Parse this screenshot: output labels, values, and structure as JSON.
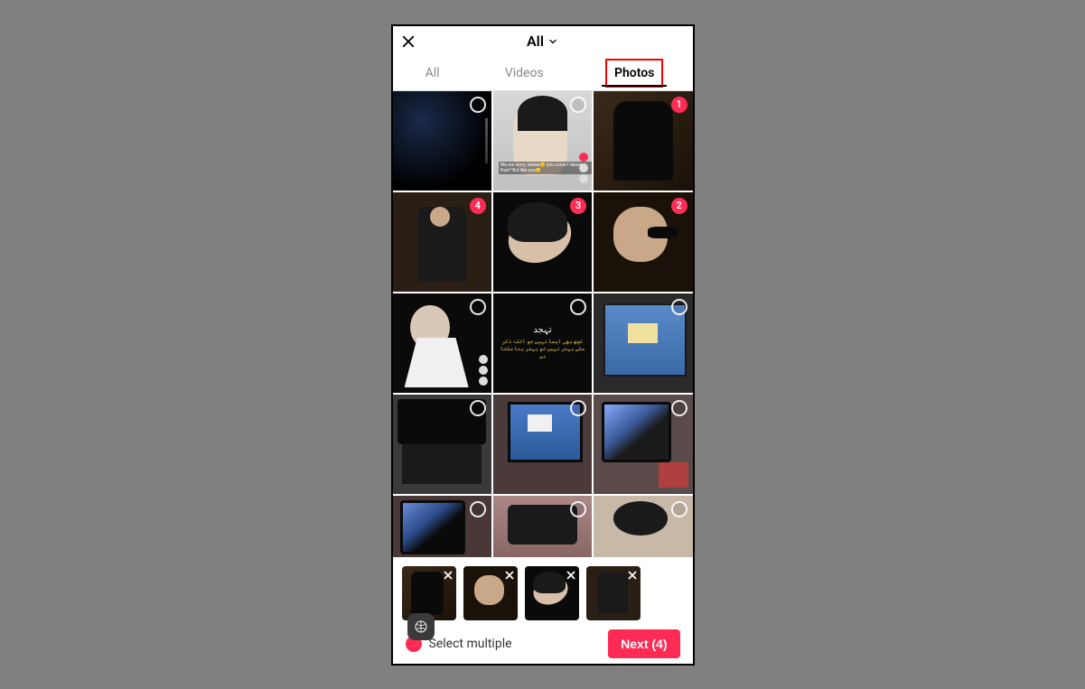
{
  "header": {
    "title": "All"
  },
  "tabs": {
    "all": "All",
    "videos": "Videos",
    "photos": "Photos",
    "active": "Photos",
    "highlighted": "Photos"
  },
  "grid": {
    "items": [
      {
        "id": "t1",
        "selected": false
      },
      {
        "id": "t2",
        "selected": false,
        "caption": "We are sorry, taetae😔\nyou come f deserve\nPain? But like you😔"
      },
      {
        "id": "t3",
        "selected": true,
        "badge": "1"
      },
      {
        "id": "t4",
        "selected": true,
        "badge": "4"
      },
      {
        "id": "t5",
        "selected": true,
        "badge": "3"
      },
      {
        "id": "t6",
        "selected": true,
        "badge": "2"
      },
      {
        "id": "t7",
        "selected": false
      },
      {
        "id": "t8",
        "selected": false,
        "text_top": "تہجد",
        "text_body": "کچھ بھی ایسا نہیں جو اللہ ذکر\nسکے بہتر نہیں تو بہتر بنا سکتا ہے"
      },
      {
        "id": "t9",
        "selected": false
      },
      {
        "id": "t10",
        "selected": false
      },
      {
        "id": "t11",
        "selected": false
      },
      {
        "id": "t12",
        "selected": false
      },
      {
        "id": "t13",
        "selected": false
      },
      {
        "id": "t14",
        "selected": false
      },
      {
        "id": "t15",
        "selected": false
      }
    ]
  },
  "selected_tray": [
    {
      "ref": "s1"
    },
    {
      "ref": "s2"
    },
    {
      "ref": "s3"
    },
    {
      "ref": "s4"
    }
  ],
  "footer": {
    "select_multiple_label": "Select multiple",
    "next_label": "Next (4)"
  },
  "colors": {
    "accent": "#fe2c55",
    "highlight_border": "#ff0000"
  }
}
